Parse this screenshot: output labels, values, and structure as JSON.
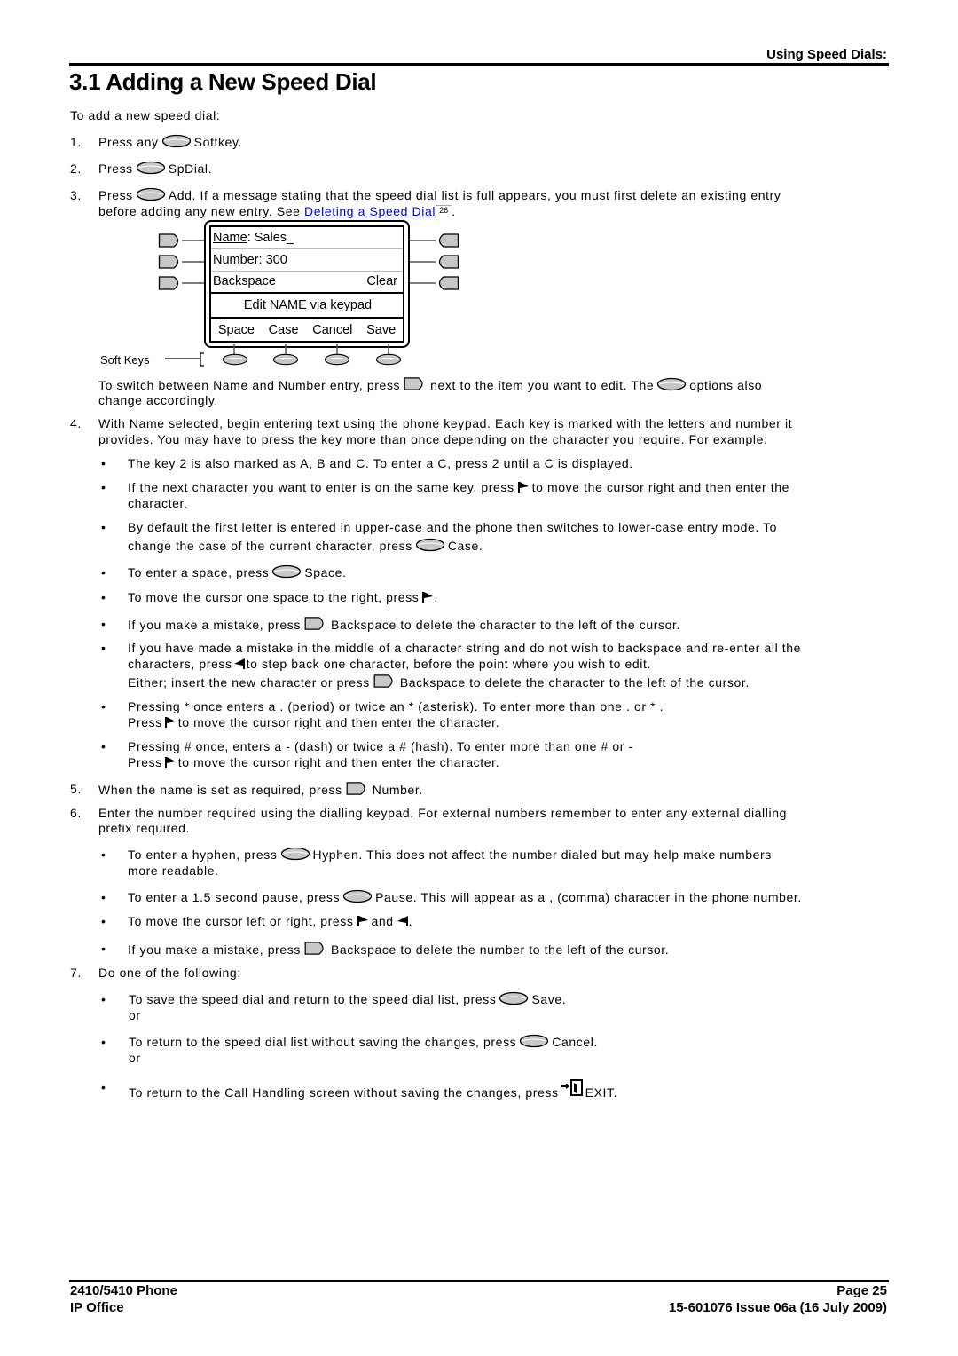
{
  "header": {
    "section": "Using Speed Dials:",
    "title": "3.1 Adding a New Speed Dial"
  },
  "intro": "To add a new speed dial:",
  "steps": {
    "s1": {
      "num": "1.",
      "pre": "Press any",
      "icon": "softkey-oval-icon",
      "post": "Softkey."
    },
    "s2": {
      "num": "2.",
      "pre": "Press",
      "icon": "softkey-oval-icon",
      "post": "SpDial."
    },
    "s3": {
      "num": "3.",
      "pre": "Press",
      "icon": "softkey-oval-icon",
      "post": "Add. If a message stating that the speed dial list is full appears, you must first delete an existing entry",
      "line2_pre": "before adding any new entry. See",
      "link": "Deleting a Speed Dial",
      "xref": "26",
      "line2_post": "."
    },
    "s3_switch": {
      "pre": "To switch between Name and Number entry, press",
      "mid": "next to the item you want to edit. The",
      "post": "options also",
      "line2": "change accordingly."
    },
    "s4": {
      "num": "4.",
      "line1": "With Name selected, begin entering text using the phone keypad. Each key is marked with the letters and number it",
      "line2": "provides. You may have to press the key more than once depending on the character you require. For example:"
    },
    "s4_bullets": [
      {
        "text": "The key 2 is also marked as A, B and C. To enter a C, press 2 until a C is displayed."
      },
      {
        "pre": "If the next character you want to enter is on the same key, press",
        "post": "to move the cursor right and then enter the",
        "line2": "character."
      },
      {
        "line1": "By default the first letter is entered in upper-case and the phone then switches to lower-case entry mode. To",
        "pre": "change the case of the current character, press",
        "post": "Case."
      },
      {
        "pre": "To enter a space, press",
        "post": "Space."
      },
      {
        "pre": "To move the cursor one space to the right, press",
        "post": "."
      },
      {
        "pre": "If you make a mistake, press",
        "post": "Backspace to delete the character to the left of the cursor."
      },
      {
        "line1": "If you have made a mistake in the middle of a character string and do not wish to backspace and re-enter all the",
        "pre": "characters, press",
        "post": "to step back one character, before the point where you wish to edit.",
        "line3_pre": "Either; insert the new character or press",
        "line3_post": "Backspace to delete the character to the left of the cursor."
      },
      {
        "line1": "Pressing *  once enters a . (period) or twice an *  (asterisk). To enter more than one . or * .",
        "pre": "Press",
        "post": "to move the cursor right and then enter the character."
      },
      {
        "line1": "Pressing #  once, enters a - (dash) or twice a #  (hash). To enter more than one #  or -",
        "pre": "Press",
        "post": "to move the cursor right and then enter the character."
      }
    ],
    "s5": {
      "num": "5.",
      "pre": "When the name is set as required, press",
      "post": "Number."
    },
    "s6": {
      "num": "6.",
      "line1": "Enter the number required using the dialling keypad. For external numbers remember to enter any external dialling",
      "line2": "prefix required."
    },
    "s6_bullets": [
      {
        "pre": "To enter a hyphen, press",
        "post": "Hyphen. This does not affect the number dialed but may help make numbers",
        "line2": "more readable."
      },
      {
        "pre": "To enter a 1.5 second pause, press",
        "post": "Pause. This will appear as a , (comma) character in the phone number."
      },
      {
        "pre": "To move the cursor left or right, press",
        "mid": "and",
        "post": "."
      },
      {
        "pre": "If you make a mistake, press",
        "post": "Backspace to delete the number to the left of the cursor."
      }
    ],
    "s7": {
      "num": "7.",
      "text": "Do one of the following:"
    },
    "s7_bullets": [
      {
        "pre": "To save the speed dial and return to the speed dial list, press",
        "post": "Save.",
        "or": "or"
      },
      {
        "pre": "To return to the speed dial list without saving the changes, press",
        "post": "Cancel.",
        "or": "or"
      },
      {
        "pre": "To return to the Call Handling screen without saving the changes, press",
        "post": "EXIT."
      }
    ]
  },
  "phone_display": {
    "name_label": "Name",
    "name_value": ":  Sales_",
    "number_line": "Number: 300",
    "backspace": "Backspace",
    "clear": "Clear",
    "prompt": "Edit NAME via keypad",
    "softkeys": [
      "Space",
      "Case",
      "Cancel",
      "Save"
    ],
    "softkeys_label": "Soft Keys"
  },
  "bullet": "•",
  "footer": {
    "left1": "2410/5410 Phone",
    "left2": "IP Office",
    "right1": "Page 25",
    "right2": "15-601076 Issue 06a (16 July 2009)"
  }
}
